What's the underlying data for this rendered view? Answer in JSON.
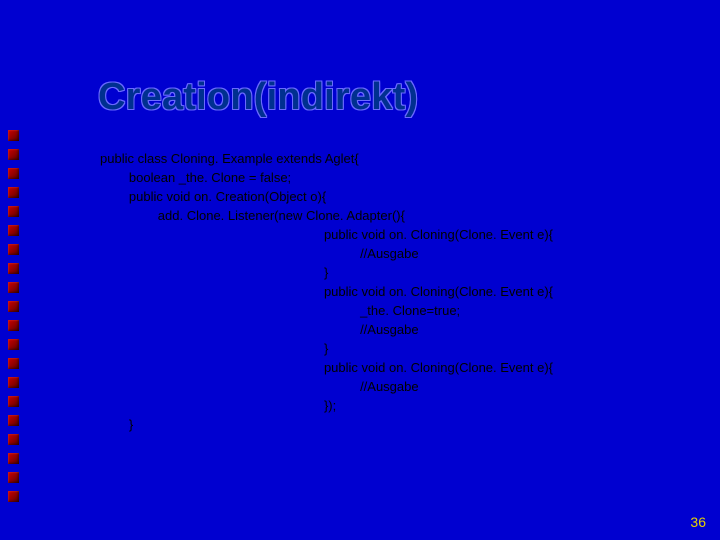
{
  "slide": {
    "title": "Creation(indirekt)",
    "page_number": "36"
  },
  "code": {
    "l1": "public class Cloning. Example extends Aglet{",
    "l2": "boolean _the. Clone = false;",
    "l3": "public void on. Creation(Object o){",
    "l4": "add. Clone. Listener(new Clone. Adapter(){",
    "l5": "public void on. Cloning(Clone. Event e){",
    "l6": "//Ausgabe",
    "l7": "}",
    "l8": "public void on. Cloning(Clone. Event e){",
    "l9": "_the. Clone=true;",
    "l10": "//Ausgabe",
    "l11": "}",
    "l12": "public void on. Cloning(Clone. Event e){",
    "l13": "//Ausgabe",
    "l14": "});",
    "l15": "}"
  },
  "indent": {
    "i0": "",
    "i1": "        ",
    "i2": "                ",
    "i3": "                                                              ",
    "i4": "                                                                        "
  }
}
